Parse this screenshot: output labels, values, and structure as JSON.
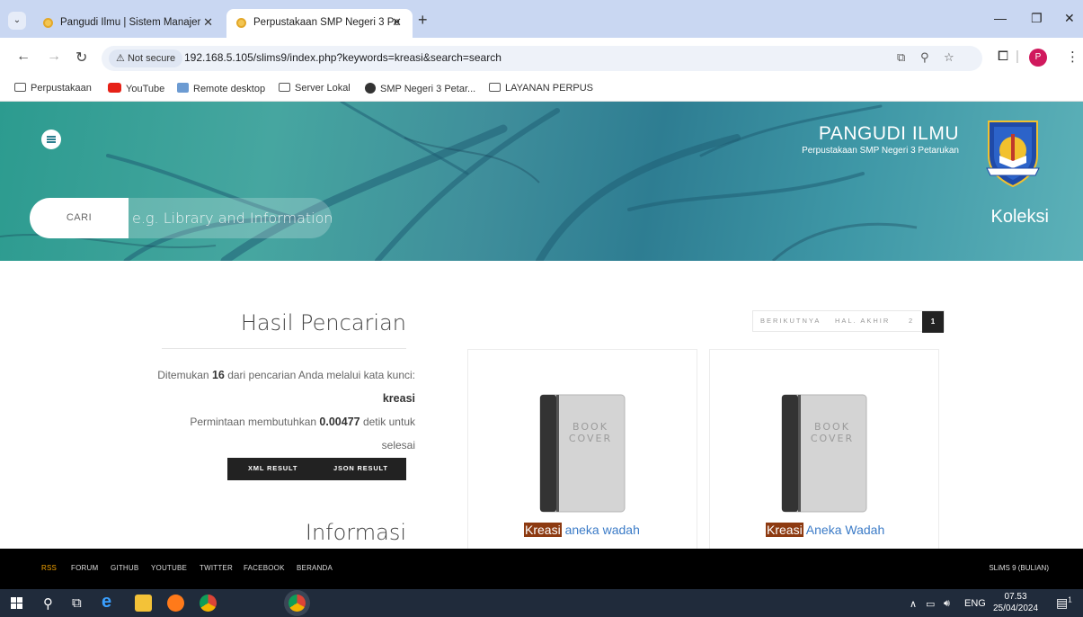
{
  "browser": {
    "tabs": [
      {
        "title": "Pangudi Ilmu | Sistem Manajer",
        "active": false
      },
      {
        "title": "Perpustakaan SMP Negeri 3 Pe",
        "active": true
      }
    ],
    "close_glyph": "✕",
    "new_tab_glyph": "+",
    "security_label": "Not secure",
    "url": "192.168.5.105/slims9/index.php?keywords=kreasi&search=search",
    "bookmarks": [
      {
        "label": "Perpustakaan",
        "icon": "folder-icon"
      },
      {
        "label": "YouTube",
        "icon": "youtube-icon"
      },
      {
        "label": "Remote desktop",
        "icon": "remote-desktop-icon"
      },
      {
        "label": "Server Lokal",
        "icon": "folder-icon"
      },
      {
        "label": "SMP Negeri 3 Petar...",
        "icon": "globe-icon"
      },
      {
        "label": "LAYANAN PERPUS",
        "icon": "folder-icon"
      }
    ],
    "profile_initial": "P"
  },
  "site": {
    "library_name": "PANGUDI ILMU",
    "library_subtitle": "Perpustakaan SMP Negeri 3 Petarukan",
    "search_label": "CARI",
    "search_placeholder": "e.g. Library and Information",
    "collection_link": "Koleksi"
  },
  "results": {
    "heading": "Hasil Pencarian",
    "found_prefix": "Ditemukan",
    "found_count": "16",
    "found_mid": "dari pencarian Anda melalui kata kunci:",
    "keyword": "kreasi",
    "time_prefix": "Permintaan membutuhkan",
    "time_value": "0.00477",
    "time_suffix": "detik untuk selesai",
    "xml_button": "XML RESULT",
    "json_button": "JSON RESULT",
    "info_heading": "Informasi"
  },
  "pagination": {
    "next": "BERIKUTNYA",
    "last": "HAL. AKHIR",
    "page_2": "2",
    "current": "1"
  },
  "books": [
    {
      "highlight": "Kreasi",
      "rest": " aneka wadah",
      "cover_text": "BOOK COVER"
    },
    {
      "highlight": "Kreasi",
      "rest": " Aneka Wadah",
      "cover_text": "BOOK COVER"
    }
  ],
  "footer": {
    "links": [
      "RSS",
      "FORUM",
      "GITHUB",
      "YOUTUBE",
      "TWITTER",
      "FACEBOOK",
      "BERANDA"
    ],
    "version": "SLiMS 9 (BULIAN)"
  },
  "taskbar": {
    "language": "ENG",
    "time": "07.53",
    "date": "25/04/2024",
    "notification_count": "1"
  },
  "colors": {
    "keyword_highlight": "#8d3a11",
    "title_link": "#3b7bc7",
    "footer_bg": "#000000",
    "rss_accent": "#f4a300"
  }
}
